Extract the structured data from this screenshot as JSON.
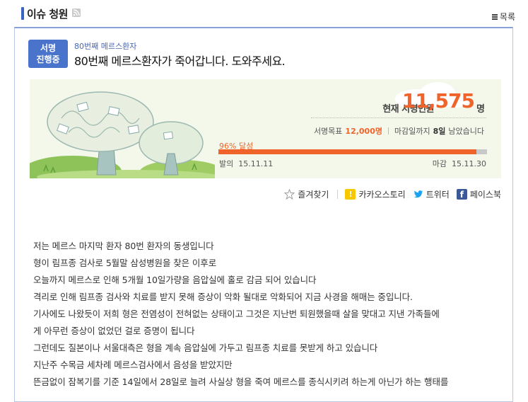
{
  "header": {
    "title": "이슈 청원",
    "list_label": "목록"
  },
  "petition": {
    "status_badge_line1": "서명",
    "status_badge_line2": "진행중",
    "subtitle": "80번째 메르스환자",
    "title": "80번째 메르스환자가 죽어갑니다. 도와주세요."
  },
  "stats": {
    "count_label": "현재 서명인원",
    "count_value": "11,575",
    "count_unit": "명",
    "goal_label": "서명목표",
    "goal_value": "12,000명",
    "deadline_prefix": "마감일까지",
    "deadline_days": "8일",
    "deadline_suffix": "남았습니다",
    "progress_percent": 96,
    "progress_label": "96% 달성",
    "start_label": "발의",
    "start_date": "15.11.11",
    "end_label": "마감",
    "end_date": "15.11.30"
  },
  "share": {
    "favorite": "즐겨찾기",
    "kakaostory": "카카오스토리",
    "twitter": "트위터",
    "facebook": "페이스북"
  },
  "body_lines": [
    "저는 메르스 마지막 환자 80번 환자의 동생입니다",
    "형이 림프종 검사로 5월말 삼성병원을 찾은 이후로",
    "오늘까지 메르스로 인해 5개월 10일가량을 음압실에 홀로 감금 되어 있습니다",
    "격리로 인해 림프종 검사와 치료를 받지 못해 증상이 악화 될대로 악화되어 지금 사경을 해매는 중입니다.",
    "기사에도 나왔듯이 저희 형은 전염성이 전혀없는 상태이고 그것은 지난번 퇴원했을때 살을 맞대고 지낸 가족들에",
    "게 아무런 증상이 없었던 걸로 증명이 됩니다",
    "그런데도 질본이나 서울대측은 형을 계속 음압실에 가두고 림프종 치료를 못받게 하고 있습니다",
    "지난주 수목금 세차례 메르스검사에서 음성을 받았지만",
    "뜬금없이 잠복기를 기준 14일에서 28일로 늘려 사실상 형을 죽여 메르스를 종식시키려 하는게 아닌가 하는 행태를"
  ],
  "colors": {
    "accent": "#f0642b",
    "brand": "#4a74cc",
    "panel_bg": "#f4f8ea"
  }
}
